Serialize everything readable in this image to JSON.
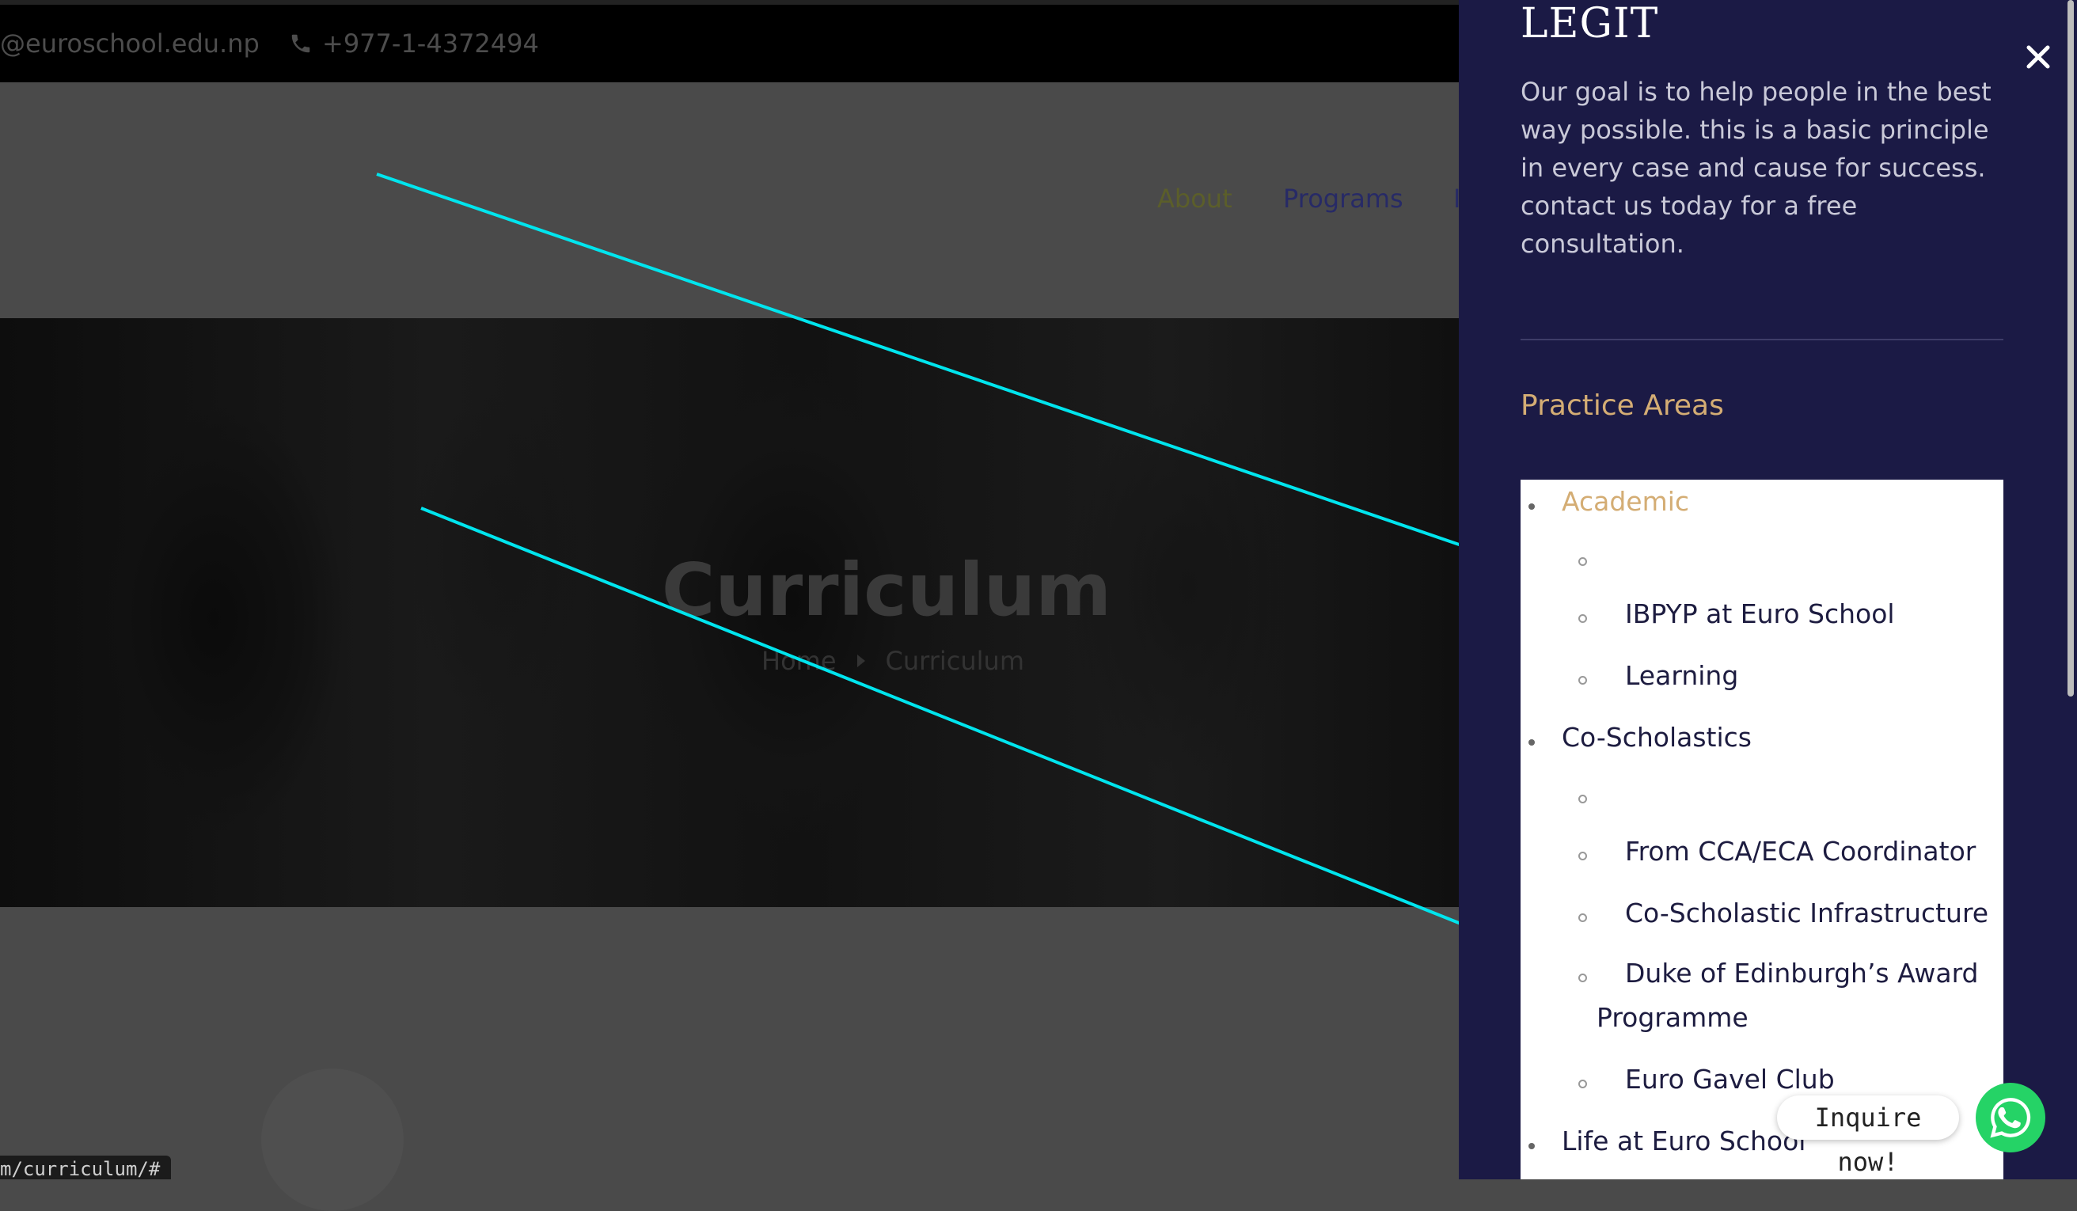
{
  "topbar": {
    "email": "@euroschool.edu.np",
    "phone": "+977-1-4372494"
  },
  "nav": {
    "about": "About",
    "programs": "Programs",
    "more": "I"
  },
  "hero": {
    "title": "Curriculum",
    "breadcrumb_home": "Home",
    "breadcrumb_current": "Curriculum"
  },
  "status_url": "m/curriculum/#",
  "panel": {
    "title": "LEGIT",
    "description": "Our goal is to help people in the best way possible. this is a basic principle in every case and cause for success. contact us today for a free consultation.",
    "heading": "Practice Areas",
    "menu": {
      "academic": "Academic",
      "academic_sub_1": "",
      "academic_sub_2": "IBPYP at Euro School",
      "academic_sub_3": "Learning",
      "coscholastics": "Co-Scholastics",
      "cosch_sub_1": "",
      "cosch_sub_2": "From CCA/ECA Coordinator",
      "cosch_sub_3": "Co-Scholastic Infrastructure",
      "cosch_sub_4a": "Duke of Edinburgh’s Award",
      "cosch_sub_4b": "Programme",
      "cosch_sub_5": "Euro Gavel Club",
      "life": "Life at Euro School"
    }
  },
  "inquire_label": "Inquire  now!",
  "colors": {
    "panel_bg": "#1b1a45",
    "accent_gold": "#d4ad74",
    "arrow_cyan": "#00e5ee",
    "whatsapp_green": "#25d366"
  }
}
